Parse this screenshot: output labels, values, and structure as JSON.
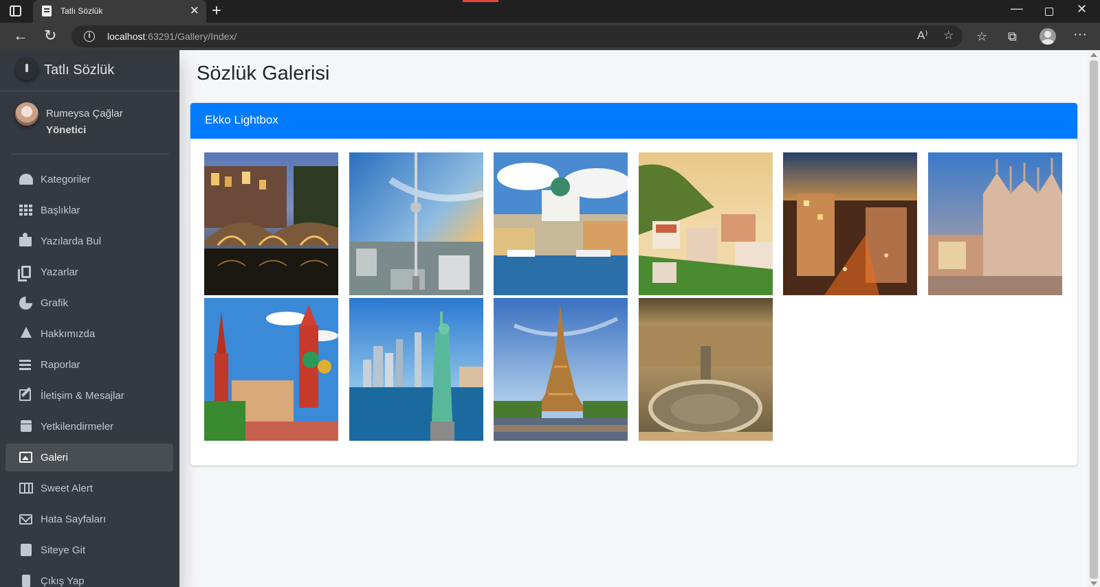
{
  "browser": {
    "tab_title": "Tatlı Sözlük",
    "tab_close": "✕",
    "new_tab": "+",
    "url_host": "localhost",
    "url_rest": ":63291/Gallery/Index/",
    "read_aloud_icon": "A⁾",
    "win_min": "—",
    "win_close": "✕",
    "back_icon": "←",
    "refresh_icon": "↻",
    "favorites_icon": "☆",
    "collections_icon": "⧉",
    "more_icon": "···"
  },
  "sidebar": {
    "brand": "Tatlı Sözlük",
    "user": {
      "name": "Rumeysa Çağlar",
      "role": "Yönetici"
    },
    "items": [
      {
        "label": "Kategoriler",
        "icon": "gauge-icon"
      },
      {
        "label": "Başlıklar",
        "icon": "grid-icon"
      },
      {
        "label": "Yazılarda Bul",
        "icon": "book-reader-icon"
      },
      {
        "label": "Yazarlar",
        "icon": "copy-icon"
      },
      {
        "label": "Grafik",
        "icon": "pie-chart-icon"
      },
      {
        "label": "Hakkımızda",
        "icon": "tree-icon"
      },
      {
        "label": "Raporlar",
        "icon": "bars-icon"
      },
      {
        "label": "İletişim & Mesajlar",
        "icon": "edit-icon"
      },
      {
        "label": "Yetkilendirmeler",
        "icon": "calendar-icon"
      },
      {
        "label": "Galeri",
        "icon": "image-icon",
        "active": true
      },
      {
        "label": "Sweet Alert",
        "icon": "map-icon"
      },
      {
        "label": "Hata Sayfaları",
        "icon": "envelope-icon"
      },
      {
        "label": "Siteye Git",
        "icon": "book-icon"
      },
      {
        "label": "Çıkış Yap",
        "icon": "door-icon"
      }
    ]
  },
  "main": {
    "title": "Sözlük Galerisi",
    "card_title": "Ekko Lightbox",
    "images": [
      {
        "name": "amsterdam-canal-photo"
      },
      {
        "name": "berlin-tv-tower-photo"
      },
      {
        "name": "helsinki-harbor-photo"
      },
      {
        "name": "lisbon-hillside-photo"
      },
      {
        "name": "madrid-night-photo"
      },
      {
        "name": "milan-cathedral-photo"
      },
      {
        "name": "moscow-kremlin-photo"
      },
      {
        "name": "new-york-liberty-photo"
      },
      {
        "name": "paris-eiffel-photo"
      },
      {
        "name": "vatican-square-photo"
      }
    ]
  }
}
